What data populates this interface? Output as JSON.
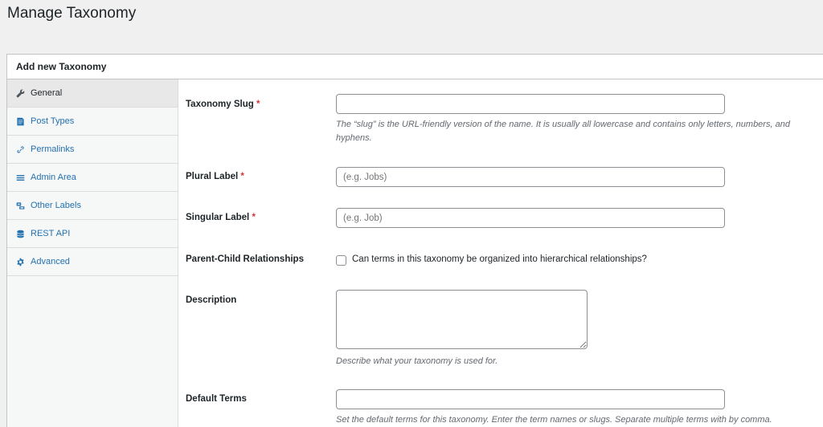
{
  "page_title": "Manage Taxonomy",
  "panel_title": "Add new Taxonomy",
  "sidebar": {
    "items": [
      {
        "label": "General",
        "icon": "wrench-icon",
        "active": true
      },
      {
        "label": "Post Types",
        "icon": "post-icon",
        "active": false
      },
      {
        "label": "Permalinks",
        "icon": "link-icon",
        "active": false
      },
      {
        "label": "Admin Area",
        "icon": "menu-icon",
        "active": false
      },
      {
        "label": "Other Labels",
        "icon": "labels-icon",
        "active": false
      },
      {
        "label": "REST API",
        "icon": "database-icon",
        "active": false
      },
      {
        "label": "Advanced",
        "icon": "gear-icon",
        "active": false
      }
    ]
  },
  "form": {
    "taxonomy_slug": {
      "label": "Taxonomy Slug",
      "required_mark": "*",
      "value": "",
      "placeholder": "",
      "description_line1": "The “slug” is the URL-friendly version of the name. It is usually all lowercase and contains only letters, numbers, and",
      "description_line2": "hyphens."
    },
    "plural_label": {
      "label": "Plural Label",
      "required_mark": "*",
      "value": "",
      "placeholder": "(e.g. Jobs)"
    },
    "singular_label": {
      "label": "Singular Label",
      "required_mark": "*",
      "value": "",
      "placeholder": "(e.g. Job)"
    },
    "parent_child": {
      "label": "Parent-Child Relationships",
      "checkbox_label": "Can terms in this taxonomy be organized into hierarchical relationships?",
      "checked": false
    },
    "description": {
      "label": "Description",
      "value": "",
      "help": "Describe what your taxonomy is used for."
    },
    "default_terms": {
      "label": "Default Terms",
      "value": "",
      "placeholder": "",
      "help": "Set the default terms for this taxonomy. Enter the term names or slugs. Separate multiple terms with by comma."
    }
  }
}
